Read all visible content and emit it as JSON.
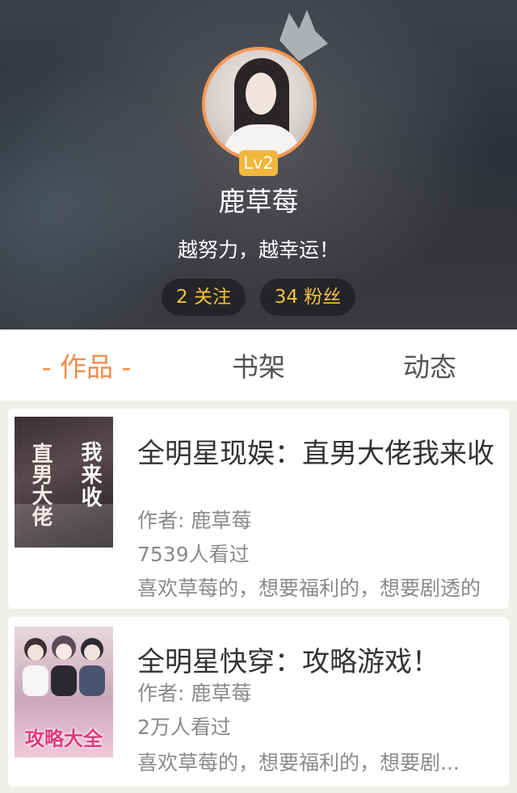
{
  "profile": {
    "level": "Lv2",
    "username": "鹿草莓",
    "motto": "越努力，越幸运！",
    "following_label": "2 关注",
    "fans_label": "34 粉丝"
  },
  "tabs": [
    {
      "label": "- 作品 -",
      "active": true
    },
    {
      "label": "书架",
      "active": false
    },
    {
      "label": "动态",
      "active": false
    }
  ],
  "books": [
    {
      "title": "全明星现娱：直男大佬我来收",
      "cover_text_main": "直男大佬",
      "cover_text_side": "我来收",
      "author": "作者: 鹿草莓",
      "views": "7539人看过",
      "description": "喜欢草莓的，想要福利的，想要剧透的"
    },
    {
      "title": "全明星快穿：攻略游戏！",
      "cover_text_main": "攻略大全",
      "author": "作者: 鹿草莓",
      "views": "2万人看过",
      "description": "喜欢草莓的，想要福利的，想要剧..."
    }
  ],
  "colors": {
    "accent": "#f08c4a",
    "level_badge": "#f3b73b",
    "stat_text": "#f2c23c"
  },
  "icons": {
    "crown": "crown-icon"
  }
}
